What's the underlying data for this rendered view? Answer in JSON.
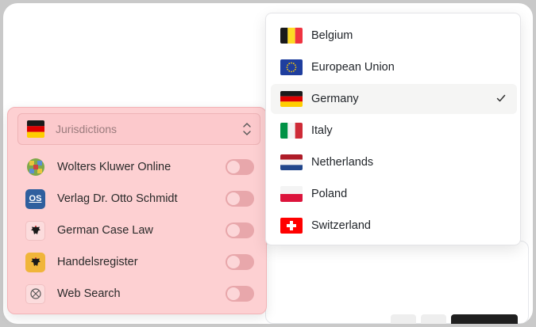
{
  "sources_panel": {
    "jurisdiction_select": {
      "label": "Jurisdictions",
      "flag": "germany"
    },
    "sources": [
      {
        "label": "Wolters Kluwer Online",
        "icon": "wolters-kluwer-logo",
        "enabled": false
      },
      {
        "label": "Verlag Dr. Otto Schmidt",
        "icon": "otto-schmidt-logo",
        "icon_text": "OS",
        "enabled": false
      },
      {
        "label": "German Case Law",
        "icon": "federal-eagle-icon",
        "enabled": false
      },
      {
        "label": "Handelsregister",
        "icon": "federal-eagle-icon",
        "enabled": false
      },
      {
        "label": "Web Search",
        "icon": "globe-icon",
        "enabled": false
      }
    ]
  },
  "jurisdiction_dropdown": {
    "selected": "Germany",
    "options": [
      {
        "label": "Belgium",
        "flag": "belgium"
      },
      {
        "label": "European Union",
        "flag": "eu"
      },
      {
        "label": "Germany",
        "flag": "germany",
        "selected": true
      },
      {
        "label": "Italy",
        "flag": "italy"
      },
      {
        "label": "Netherlands",
        "flag": "netherlands"
      },
      {
        "label": "Poland",
        "flag": "poland"
      },
      {
        "label": "Switzerland",
        "flag": "switzerland"
      }
    ]
  },
  "colors": {
    "panel_tint": "#fdd0d2",
    "toggle_off": "#e8a7ab",
    "selected_row": "#f5f5f4"
  }
}
